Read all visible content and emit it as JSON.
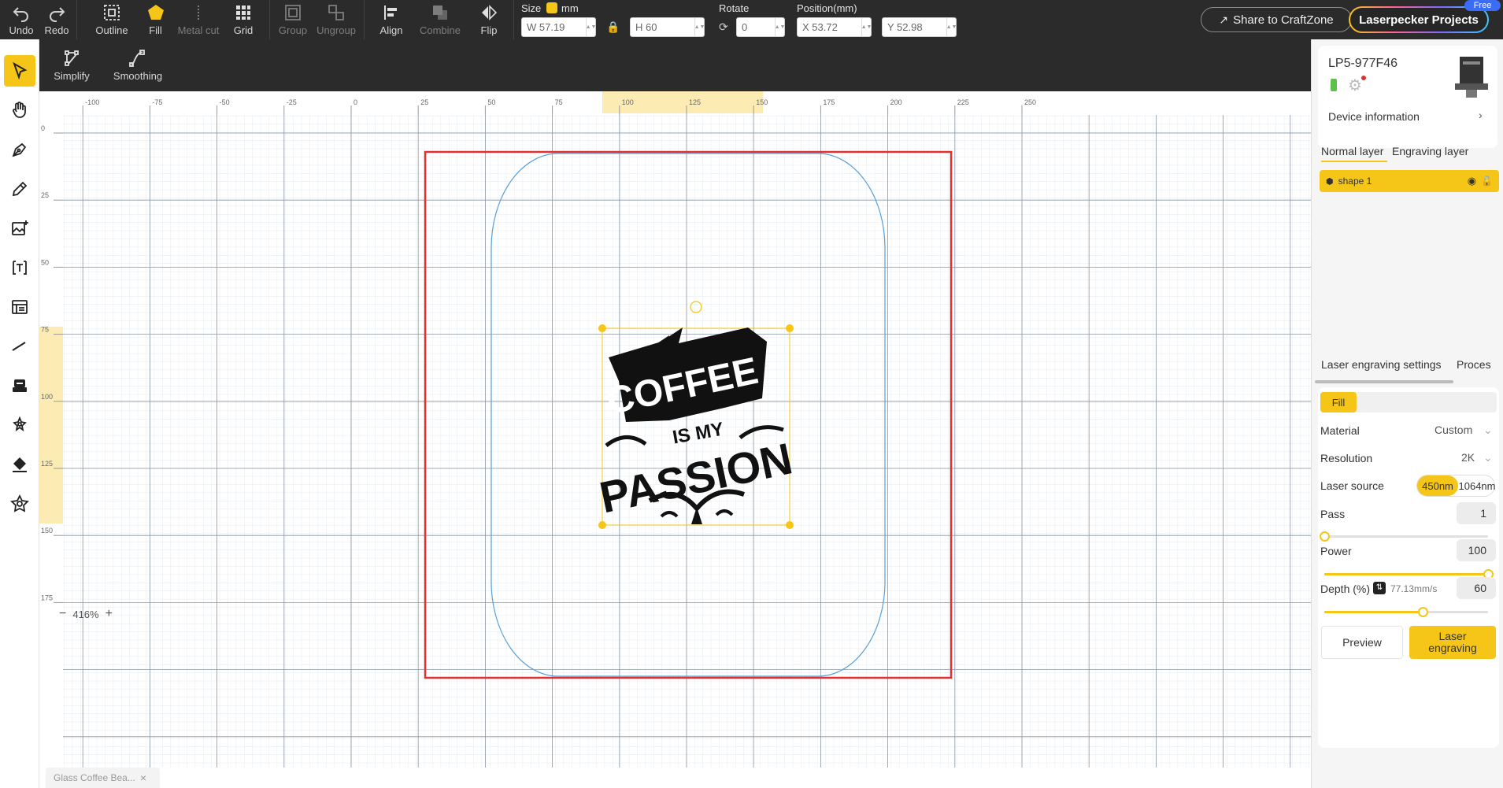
{
  "toolbar": {
    "undo": "Undo",
    "redo": "Redo",
    "outline": "Outline",
    "fill": "Fill",
    "metal_cut": "Metal cut",
    "grid": "Grid",
    "group": "Group",
    "ungroup": "Ungroup",
    "align": "Align",
    "combine": "Combine",
    "flip": "Flip",
    "size_label": "Size",
    "size_unit": "mm",
    "width": "W 57.19",
    "height": "H 60",
    "rotate_label": "Rotate",
    "rotate_value": "0",
    "position_label": "Position(mm)",
    "pos_x": "X 53.72",
    "pos_y": "Y 52.98",
    "share_label": "Share to CraftZone",
    "projects_label": "Laserpecker Projects",
    "free_badge": "Free"
  },
  "subbar": {
    "simplify": "Simplify",
    "smoothing": "Smoothing"
  },
  "left_tools": [
    "select-icon",
    "hand-icon",
    "pen-icon",
    "pencil-icon",
    "image-icon",
    "text-icon",
    "table-icon",
    "line-icon",
    "stamp-icon",
    "magic-icon",
    "paint-bucket-icon",
    "star-shape-icon"
  ],
  "ruler": {
    "h_labels": [
      "-100",
      "-75",
      "-50",
      "-25",
      "0",
      "25",
      "50",
      "75",
      "100",
      "125",
      "150",
      "175",
      "200",
      "225",
      "250"
    ],
    "v_labels": [
      "0",
      "25",
      "50",
      "75",
      "100",
      "125",
      "150",
      "175"
    ]
  },
  "artwork": {
    "word1": "COFFEE",
    "word2": "IS MY",
    "word3": "PASSION"
  },
  "canvas": {
    "zoom": "416%",
    "file_tab": "Glass Coffee Bea..."
  },
  "device": {
    "name": "LP5-977F46",
    "info_label": "Device information"
  },
  "layers": {
    "tabs": [
      "Normal layer",
      "Engraving layer"
    ],
    "items": [
      {
        "name": "shape 1"
      }
    ]
  },
  "settings": {
    "tabs": [
      "Laser engraving settings",
      "Proces"
    ],
    "mode": "Fill",
    "material_label": "Material",
    "material_value": "Custom",
    "resolution_label": "Resolution",
    "resolution_value": "2K",
    "laser_source_label": "Laser source",
    "laser_options": [
      "450nm",
      "1064nm"
    ],
    "pass_label": "Pass",
    "pass_value": "1",
    "pass_level": 0.0,
    "power_label": "Power",
    "power_value": "100",
    "power_level": 1.0,
    "depth_label": "Depth (%)",
    "speed": "77.13mm/s",
    "depth_value": "60",
    "depth_level": 0.6,
    "preview_label": "Preview",
    "engrave_label": "Laser engraving"
  },
  "colors": {
    "accent": "#f5c518",
    "dark": "#2b2b2b",
    "work_area": "#e03030",
    "outline": "#5aa0d8"
  }
}
